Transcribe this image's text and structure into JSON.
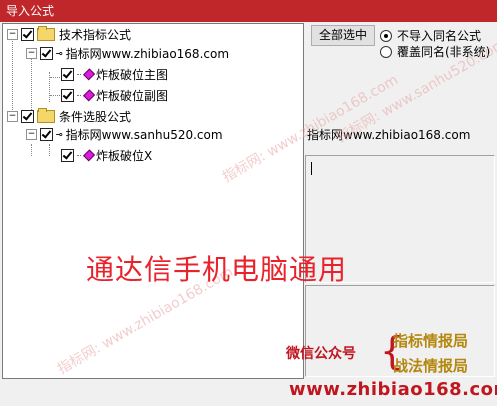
{
  "window": {
    "title": "导入公式"
  },
  "tree": {
    "group1": {
      "label": "技术指标公式"
    },
    "group1_child": {
      "label": "指标网www.zhibiao168.com"
    },
    "group1_items": [
      "炸板破位主图",
      "炸板破位副图"
    ],
    "group2": {
      "label": "条件选股公式"
    },
    "group2_child": {
      "label": "指标网www.sanhu520.com"
    },
    "group2_items": [
      "炸板破位X"
    ]
  },
  "buttons": {
    "select_all": "全部选中"
  },
  "options": {
    "no_import": "不导入同名公式",
    "overwrite": "覆盖同名(非系统)",
    "selected": "no_import"
  },
  "detail": {
    "source": "指标网www.zhibiao168.com"
  },
  "overlay": {
    "headline": "通达信手机电脑通用",
    "wechat_label": "微信公众号",
    "wechat_name_1": "指标情报局",
    "wechat_name_2": "战法情报局",
    "site": "www.zhibiao168.com",
    "watermark_1": "指标网: www.zhibiao168.com",
    "watermark_2": "指标网: www.sanhu520.com",
    "watermark_3": "指标网: www.zhibiao168.com",
    "brace": "{"
  },
  "colors": {
    "titlebar": "#c0272b",
    "accent_red": "#c0161f",
    "accent_gold": "#b4870e"
  }
}
